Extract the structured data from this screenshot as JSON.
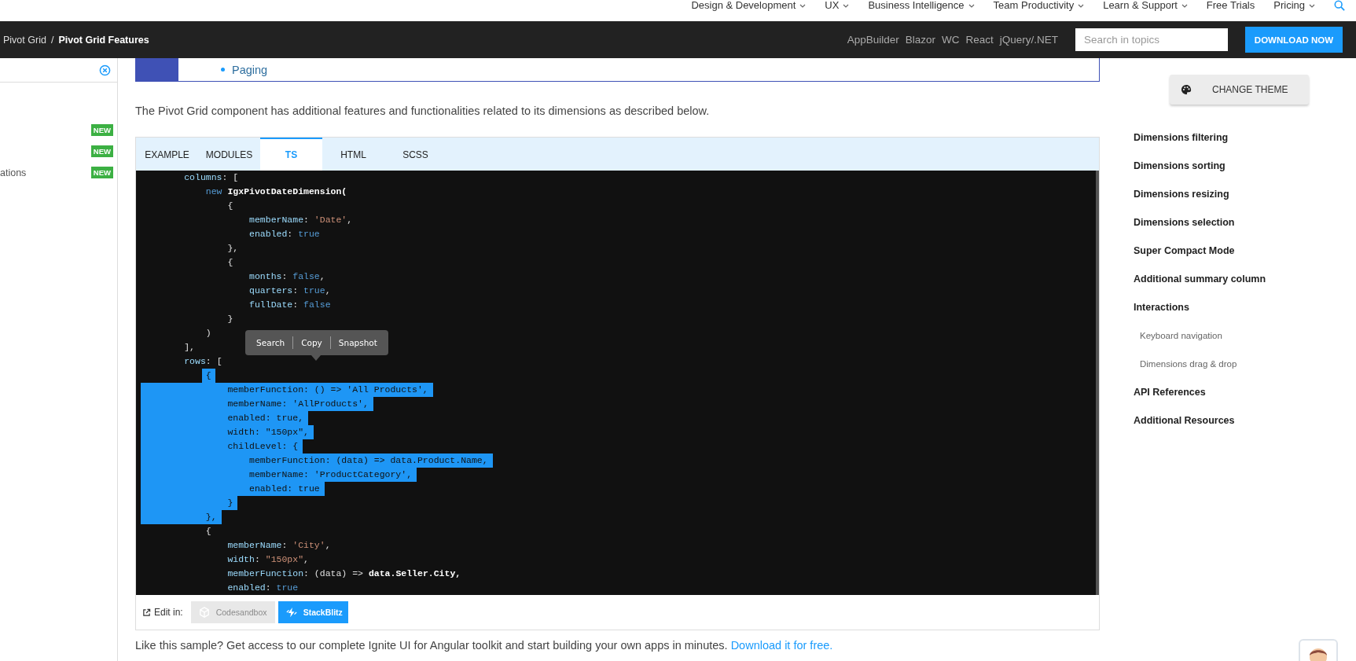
{
  "top_nav": {
    "items": [
      {
        "label": "Design & Development",
        "has_menu": true
      },
      {
        "label": "UX",
        "has_menu": true
      },
      {
        "label": "Business Intelligence",
        "has_menu": true
      },
      {
        "label": "Team Productivity",
        "has_menu": true
      },
      {
        "label": "Learn & Support",
        "has_menu": true
      },
      {
        "label": "Free Trials",
        "has_menu": false
      },
      {
        "label": "Pricing",
        "has_menu": true
      }
    ]
  },
  "header_bar": {
    "breadcrumb": [
      "Pivot Grid",
      "Pivot Grid Features"
    ],
    "separator": "/",
    "platforms": [
      "AppBuilder",
      "Blazor",
      "WC",
      "React",
      "jQuery/.NET"
    ],
    "search": {
      "placeholder": "Search in topics"
    },
    "download_button": "DOWNLOAD NOW"
  },
  "sidebar": {
    "items": [
      {
        "badge": "NEW"
      },
      {
        "badge": "NEW"
      },
      {
        "label": "ations",
        "badge": "NEW"
      }
    ]
  },
  "content": {
    "list_item": "Paging",
    "intro": "The Pivot Grid component has additional features and functionalities related to its dimensions as described below.",
    "code_sample": {
      "tabs": [
        {
          "label": "EXAMPLE",
          "selected": false
        },
        {
          "label": "MODULES",
          "selected": false
        },
        {
          "label": "TS",
          "selected": true
        },
        {
          "label": "HTML",
          "selected": false
        },
        {
          "label": "SCSS",
          "selected": false
        }
      ],
      "lines": [
        {
          "selected": false,
          "tokens": [
            {
              "kind": "key",
              "text": "        columns"
            },
            {
              "kind": "plain",
              "text": ": ["
            }
          ]
        },
        {
          "selected": false,
          "tokens": [
            {
              "kind": "kw",
              "text": "            new"
            },
            {
              "kind": "ident",
              "text": " IgxPivotDateDimension("
            }
          ]
        },
        {
          "selected": false,
          "tokens": [
            {
              "kind": "plain",
              "text": "                {"
            }
          ]
        },
        {
          "selected": false,
          "tokens": [
            {
              "kind": "key",
              "text": "                    memberName"
            },
            {
              "kind": "plain",
              "text": ": "
            },
            {
              "kind": "str",
              "text": "'Date'"
            },
            {
              "kind": "plain",
              "text": ","
            }
          ]
        },
        {
          "selected": false,
          "tokens": [
            {
              "kind": "key",
              "text": "                    enabled"
            },
            {
              "kind": "plain",
              "text": ": "
            },
            {
              "kind": "kw",
              "text": "true"
            }
          ]
        },
        {
          "selected": false,
          "tokens": [
            {
              "kind": "plain",
              "text": "                },"
            }
          ]
        },
        {
          "selected": false,
          "tokens": [
            {
              "kind": "plain",
              "text": "                {"
            }
          ]
        },
        {
          "selected": false,
          "tokens": [
            {
              "kind": "key",
              "text": "                    months"
            },
            {
              "kind": "plain",
              "text": ": "
            },
            {
              "kind": "kw",
              "text": "false"
            },
            {
              "kind": "plain",
              "text": ","
            }
          ]
        },
        {
          "selected": false,
          "tokens": [
            {
              "kind": "key",
              "text": "                    quarters"
            },
            {
              "kind": "plain",
              "text": ": "
            },
            {
              "kind": "kw",
              "text": "true"
            },
            {
              "kind": "plain",
              "text": ","
            }
          ]
        },
        {
          "selected": false,
          "tokens": [
            {
              "kind": "key",
              "text": "                    fullDate"
            },
            {
              "kind": "plain",
              "text": ": "
            },
            {
              "kind": "kw",
              "text": "false"
            }
          ]
        },
        {
          "selected": false,
          "tokens": [
            {
              "kind": "plain",
              "text": "                }"
            }
          ]
        },
        {
          "selected": false,
          "tokens": [
            {
              "kind": "plain",
              "text": "            )"
            }
          ]
        },
        {
          "selected": false,
          "tokens": [
            {
              "kind": "plain",
              "text": "        ],"
            }
          ]
        },
        {
          "selected": false,
          "tokens": [
            {
              "kind": "key",
              "text": "        rows"
            },
            {
              "kind": "plain",
              "text": ": ["
            }
          ]
        },
        {
          "selected": true,
          "text": "            {"
        },
        {
          "selected": true,
          "text": "                memberFunction: () => 'All Products',"
        },
        {
          "selected": true,
          "text": "                memberName: 'AllProducts',"
        },
        {
          "selected": true,
          "text": "                enabled: true,"
        },
        {
          "selected": true,
          "text": "                width: \"150px\","
        },
        {
          "selected": true,
          "text": "                childLevel: {"
        },
        {
          "selected": true,
          "text": "                    memberFunction: (data) => data.Product.Name,"
        },
        {
          "selected": true,
          "text": "                    memberName: 'ProductCategory',"
        },
        {
          "selected": true,
          "text": "                    enabled: true"
        },
        {
          "selected": true,
          "text": "                }"
        },
        {
          "selected": true,
          "text": "            },"
        },
        {
          "selected": false,
          "tokens": [
            {
              "kind": "plain",
              "text": "            {"
            }
          ]
        },
        {
          "selected": false,
          "tokens": [
            {
              "kind": "key",
              "text": "                memberName"
            },
            {
              "kind": "plain",
              "text": ": "
            },
            {
              "kind": "str",
              "text": "'City'"
            },
            {
              "kind": "plain",
              "text": ","
            }
          ]
        },
        {
          "selected": false,
          "tokens": [
            {
              "kind": "key",
              "text": "                width"
            },
            {
              "kind": "plain",
              "text": ": "
            },
            {
              "kind": "str",
              "text": "\"150px\""
            },
            {
              "kind": "plain",
              "text": ","
            }
          ]
        },
        {
          "selected": false,
          "tokens": [
            {
              "kind": "key",
              "text": "                memberFunction"
            },
            {
              "kind": "plain",
              "text": ": (data) => "
            },
            {
              "kind": "ident",
              "text": "data.Seller.City,"
            }
          ]
        },
        {
          "selected": false,
          "tokens": [
            {
              "kind": "key",
              "text": "                enabled"
            },
            {
              "kind": "plain",
              "text": ": "
            },
            {
              "kind": "kw",
              "text": "true"
            }
          ]
        }
      ],
      "popup": [
        "Search",
        "Copy",
        "Snapshot"
      ],
      "edit_label": "Edit in:",
      "editors": [
        {
          "label": "Codesandbox",
          "disabled": true
        },
        {
          "label": "StackBlitz",
          "disabled": false
        }
      ]
    },
    "outro": {
      "text": "Like this sample? Get access to our complete Ignite UI for Angular toolkit and start building your own apps in minutes. ",
      "link": "Download it for free."
    }
  },
  "toc": {
    "theme_button": "CHANGE THEME",
    "links": [
      {
        "label": "Dimensions filtering",
        "kind": "section"
      },
      {
        "label": "Dimensions sorting",
        "kind": "section"
      },
      {
        "label": "Dimensions resizing",
        "kind": "section"
      },
      {
        "label": "Dimensions selection",
        "kind": "section"
      },
      {
        "label": "Super Compact Mode",
        "kind": "section"
      },
      {
        "label": "Additional summary column",
        "kind": "section"
      },
      {
        "label": "Interactions",
        "kind": "section"
      },
      {
        "label": "Keyboard navigation",
        "kind": "subsection"
      },
      {
        "label": "Dimensions drag & drop",
        "kind": "subsection"
      },
      {
        "label": "API References",
        "kind": "section"
      },
      {
        "label": "Additional Resources",
        "kind": "section"
      }
    ]
  }
}
